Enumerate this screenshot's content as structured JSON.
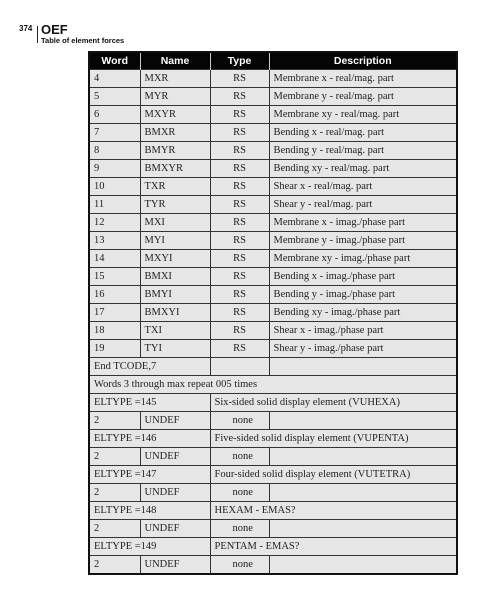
{
  "page_header": {
    "page_number": "374",
    "section_title": "OEF",
    "section_subtitle": "Table of element forces"
  },
  "table": {
    "columns": [
      "Word",
      "Name",
      "Type",
      "Description"
    ],
    "word_rows": [
      {
        "word": "4",
        "name": "MXR",
        "type": "RS",
        "description": "Membrane x - real/mag. part"
      },
      {
        "word": "5",
        "name": "MYR",
        "type": "RS",
        "description": "Membrane y - real/mag. part"
      },
      {
        "word": "6",
        "name": "MXYR",
        "type": "RS",
        "description": "Membrane xy - real/mag. part"
      },
      {
        "word": "7",
        "name": "BMXR",
        "type": "RS",
        "description": "Bending x - real/mag. part"
      },
      {
        "word": "8",
        "name": "BMYR",
        "type": "RS",
        "description": "Bending y - real/mag. part"
      },
      {
        "word": "9",
        "name": "BMXYR",
        "type": "RS",
        "description": "Bending xy - real/mag. part"
      },
      {
        "word": "10",
        "name": "TXR",
        "type": "RS",
        "description": "Shear x - real/mag. part"
      },
      {
        "word": "11",
        "name": "TYR",
        "type": "RS",
        "description": "Shear y - real/mag. part"
      },
      {
        "word": "12",
        "name": "MXI",
        "type": "RS",
        "description": "Membrane x - imag./phase part"
      },
      {
        "word": "13",
        "name": "MYI",
        "type": "RS",
        "description": "Membrane y - imag./phase part"
      },
      {
        "word": "14",
        "name": "MXYI",
        "type": "RS",
        "description": "Membrane xy - imag./phase part"
      },
      {
        "word": "15",
        "name": "BMXI",
        "type": "RS",
        "description": "Bending x - imag./phase part"
      },
      {
        "word": "16",
        "name": "BMYI",
        "type": "RS",
        "description": "Bending y - imag./phase part"
      },
      {
        "word": "17",
        "name": "BMXYI",
        "type": "RS",
        "description": "Bending xy - imag./phase part"
      },
      {
        "word": "18",
        "name": "TXI",
        "type": "RS",
        "description": "Shear x - imag./phase part"
      },
      {
        "word": "19",
        "name": "TYI",
        "type": "RS",
        "description": "Shear y - imag./phase part"
      }
    ],
    "end_tcode": "End TCODE,7",
    "repeat_note": "Words 3 through max repeat 005 times",
    "eltype_blocks": [
      {
        "eltype": "ELTYPE =145",
        "eltype_description": "Six-sided solid display element (VUHEXA)",
        "word": "2",
        "name": "UNDEF",
        "type": "none"
      },
      {
        "eltype": "ELTYPE =146",
        "eltype_description": "Five-sided solid display element (VUPENTA)",
        "word": "2",
        "name": "UNDEF",
        "type": "none"
      },
      {
        "eltype": "ELTYPE =147",
        "eltype_description": "Four-sided solid display element (VUTETRA)",
        "word": "2",
        "name": "UNDEF",
        "type": "none"
      },
      {
        "eltype": "ELTYPE =148",
        "eltype_description": "HEXAM - EMAS?",
        "word": "2",
        "name": "UNDEF",
        "type": "none"
      },
      {
        "eltype": "ELTYPE =149",
        "eltype_description": "PENTAM - EMAS?",
        "word": "2",
        "name": "UNDEF",
        "type": "none"
      }
    ]
  }
}
